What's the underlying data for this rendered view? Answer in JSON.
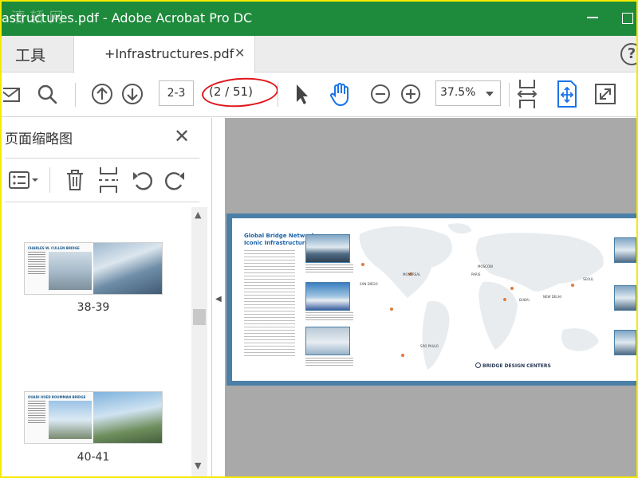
{
  "window": {
    "watermark": "清 轿 网",
    "title": "astructures.pdf - Adobe Acrobat Pro DC"
  },
  "tabs": {
    "tools_label": "工具",
    "document_label": "+Infrastructures.pdf",
    "close_glyph": "✕",
    "help_glyph": "?"
  },
  "toolbar": {
    "page_input": "2-3",
    "page_count": "(2 / 51)",
    "zoom": "37.5%"
  },
  "thumbnail_panel": {
    "title": "页面缩略图",
    "close_glyph": "✕",
    "thumbnails": [
      {
        "heading": "CHARLES W. CULLEN BRIDGE",
        "label": "38-39"
      },
      {
        "heading": "OUADI OUED ROUMMAN BRIDGE",
        "label": "40-41"
      }
    ]
  },
  "document": {
    "title_line1": "Global Bridge Network",
    "title_line2": "Iconic Infrastructures",
    "brand": "BRIDGE DESIGN CENTERS",
    "cities": [
      "MONTREAL",
      "SAN DIEGO",
      "PARIS",
      "MOSCOW",
      "SEOUL",
      "NEW DELHI",
      "DUBAI",
      "SÃO PAULO"
    ],
    "accent_color": "#1b63a8",
    "pin_color": "#e07a3c"
  }
}
